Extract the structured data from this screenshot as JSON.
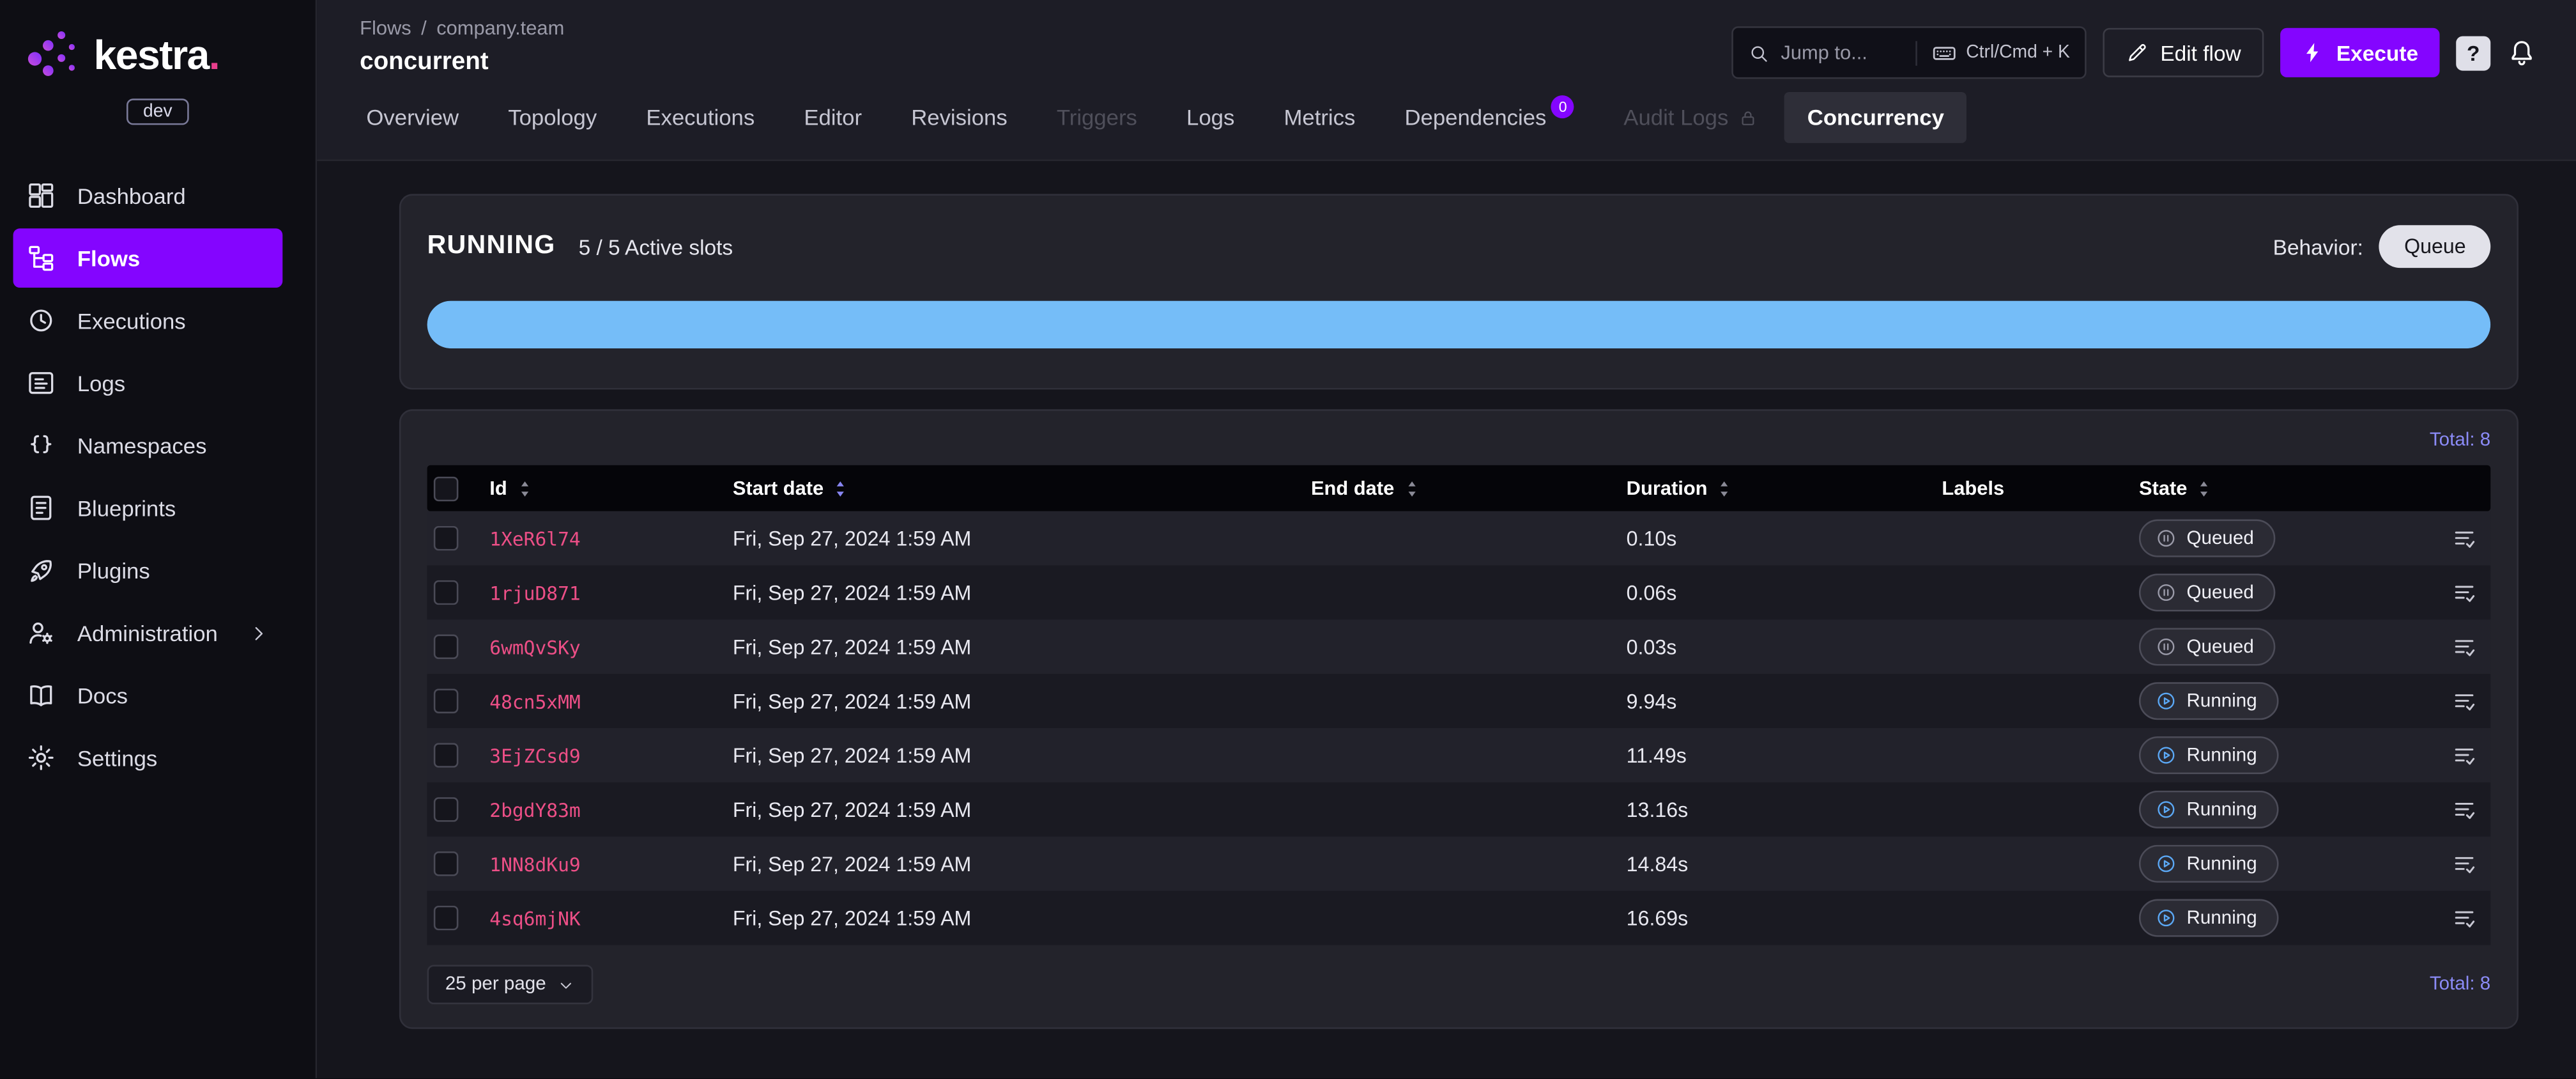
{
  "colors": {
    "accent": "#8405ff",
    "id_link": "#ed4f87",
    "progress": "#75bdf8",
    "total_text": "#8b8bf7"
  },
  "brand": {
    "name": "kestra",
    "dot": ".",
    "env": "dev"
  },
  "sidebar": {
    "items": [
      {
        "label": "Dashboard",
        "icon": "dashboard-icon"
      },
      {
        "label": "Flows",
        "icon": "flows-icon",
        "active": true
      },
      {
        "label": "Executions",
        "icon": "executions-icon"
      },
      {
        "label": "Logs",
        "icon": "logs-icon"
      },
      {
        "label": "Namespaces",
        "icon": "namespaces-icon"
      },
      {
        "label": "Blueprints",
        "icon": "blueprints-icon"
      },
      {
        "label": "Plugins",
        "icon": "plugins-icon"
      },
      {
        "label": "Administration",
        "icon": "administration-icon",
        "chevron": true
      },
      {
        "label": "Docs",
        "icon": "docs-icon"
      },
      {
        "label": "Settings",
        "icon": "settings-icon"
      }
    ]
  },
  "header": {
    "breadcrumb": {
      "parent": "Flows",
      "separator": "/",
      "namespace": "company.team"
    },
    "title": "concurrent",
    "search": {
      "placeholder": "Jump to...",
      "shortcut": "Ctrl/Cmd + K"
    },
    "buttons": {
      "edit_flow": "Edit flow",
      "execute": "Execute",
      "help": "?"
    }
  },
  "tabs": [
    {
      "label": "Overview"
    },
    {
      "label": "Topology"
    },
    {
      "label": "Executions"
    },
    {
      "label": "Editor"
    },
    {
      "label": "Revisions"
    },
    {
      "label": "Triggers",
      "disabled": true
    },
    {
      "label": "Logs"
    },
    {
      "label": "Metrics"
    },
    {
      "label": "Dependencies",
      "badge": "0"
    },
    {
      "label": "Audit Logs",
      "disabled": true,
      "lock": true
    },
    {
      "label": "Concurrency",
      "active": true
    }
  ],
  "concurrency": {
    "state": "RUNNING",
    "slots": "5 / 5 Active slots",
    "behavior_label": "Behavior:",
    "behavior_value": "Queue",
    "progress_percent": 100
  },
  "executions": {
    "total_top": "Total: 8",
    "total_bottom": "Total: 8",
    "per_page": "25 per page",
    "columns": [
      "Id",
      "Start date",
      "End date",
      "Duration",
      "Labels",
      "State"
    ],
    "sorted_column": "Start date",
    "rows": [
      {
        "id": "1XeR6l74",
        "start": "Fri, Sep 27, 2024 1:59 AM",
        "end": "",
        "duration": "0.10s",
        "labels": "",
        "state": "Queued"
      },
      {
        "id": "1rjuD871",
        "start": "Fri, Sep 27, 2024 1:59 AM",
        "end": "",
        "duration": "0.06s",
        "labels": "",
        "state": "Queued"
      },
      {
        "id": "6wmQvSKy",
        "start": "Fri, Sep 27, 2024 1:59 AM",
        "end": "",
        "duration": "0.03s",
        "labels": "",
        "state": "Queued"
      },
      {
        "id": "48cn5xMM",
        "start": "Fri, Sep 27, 2024 1:59 AM",
        "end": "",
        "duration": "9.94s",
        "labels": "",
        "state": "Running"
      },
      {
        "id": "3EjZCsd9",
        "start": "Fri, Sep 27, 2024 1:59 AM",
        "end": "",
        "duration": "11.49s",
        "labels": "",
        "state": "Running"
      },
      {
        "id": "2bgdY83m",
        "start": "Fri, Sep 27, 2024 1:59 AM",
        "end": "",
        "duration": "13.16s",
        "labels": "",
        "state": "Running"
      },
      {
        "id": "1NN8dKu9",
        "start": "Fri, Sep 27, 2024 1:59 AM",
        "end": "",
        "duration": "14.84s",
        "labels": "",
        "state": "Running"
      },
      {
        "id": "4sq6mjNK",
        "start": "Fri, Sep 27, 2024 1:59 AM",
        "end": "",
        "duration": "16.69s",
        "labels": "",
        "state": "Running"
      }
    ]
  }
}
